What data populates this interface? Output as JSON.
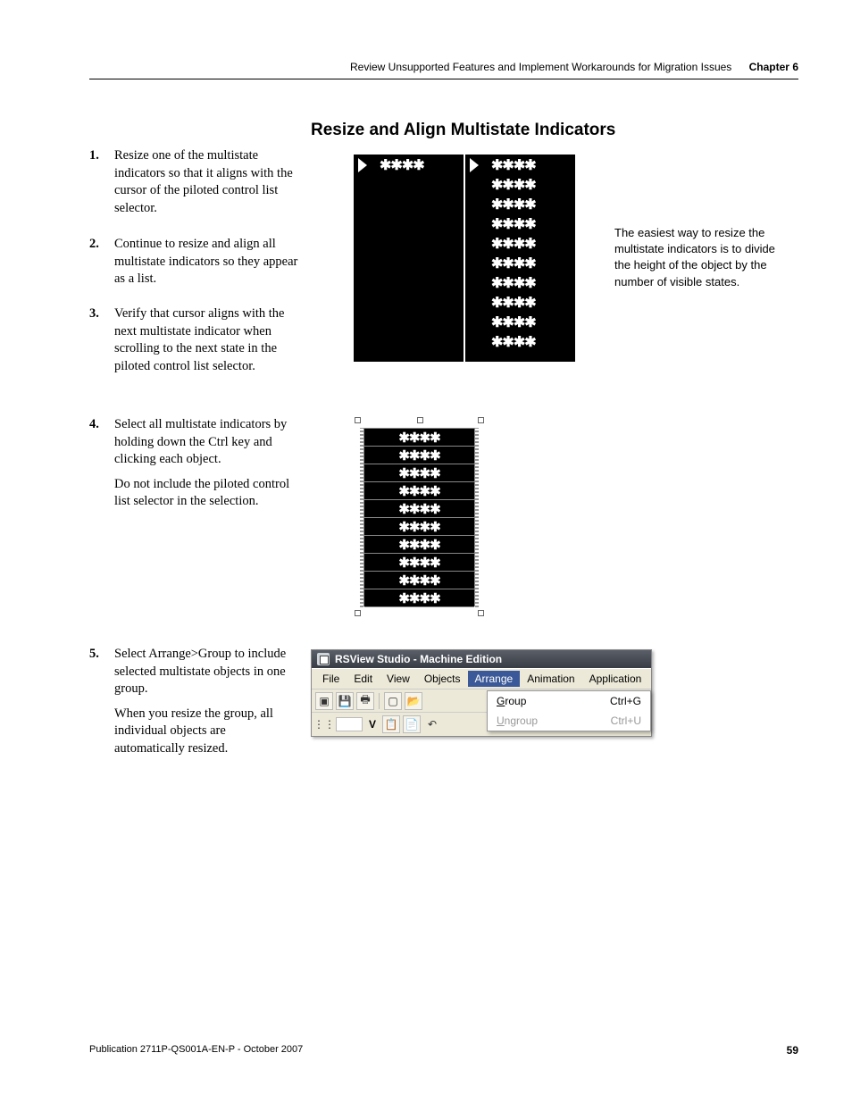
{
  "header": {
    "breadcrumb": "Review Unsupported Features and Implement Workarounds for Migration Issues",
    "chapter": "Chapter 6"
  },
  "section_title": "Resize and Align Multistate Indicators",
  "steps": {
    "s1": {
      "num": "1.",
      "body": "Resize one of the multistate indicators so that it aligns with the cursor of the piloted control list selector."
    },
    "s2": {
      "num": "2.",
      "body": "Continue to resize and align all multistate indicators so they appear as a list."
    },
    "s3": {
      "num": "3.",
      "body": "Verify that cursor aligns with the next multistate indicator when scrolling to the next state in the piloted control list selector."
    },
    "s4": {
      "num": "4.",
      "body": "Select all multistate indicators by holding down the Ctrl key and clicking each object.",
      "extra": "Do not include the piloted control list selector in the selection."
    },
    "s5": {
      "num": "5.",
      "body": "Select Arrange>Group to include selected multistate objects in one group.",
      "extra": "When you resize the group, all individual objects are automatically resized."
    }
  },
  "tip": "The easiest way to resize the multistate indicators is to divide the height of the object by the number of visible states.",
  "star_glyph": "✱✱✱✱",
  "appwin": {
    "title": "RSView Studio - Machine Edition",
    "menu": [
      "File",
      "Edit",
      "View",
      "Objects",
      "Arrange",
      "Animation",
      "Application"
    ],
    "selected_menu": "Arrange",
    "dropdown": [
      {
        "label": "Group",
        "mnemonic": "G",
        "shortcut": "Ctrl+G",
        "enabled": true
      },
      {
        "label": "Ungroup",
        "mnemonic": "U",
        "shortcut": "Ctrl+U",
        "enabled": false
      }
    ]
  },
  "footer": {
    "pub": "Publication 2711P-QS001A-EN-P - October 2007",
    "page": "59"
  }
}
